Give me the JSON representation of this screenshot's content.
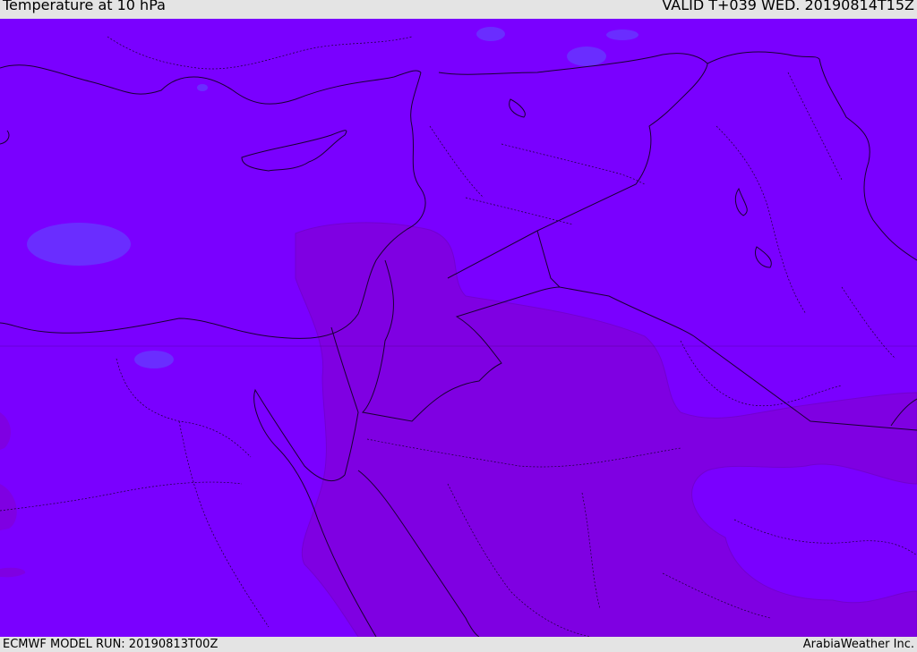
{
  "header": {
    "title": "Temperature at 10 hPa",
    "valid": "VALID T+039 WED. 20190814T15Z"
  },
  "footer": {
    "model_run": "ECMWF MODEL RUN: 20190813T00Z",
    "credit": "ArabiaWeather Inc."
  },
  "map": {
    "colors": {
      "field_main": "#7a00ff",
      "field_warm": "#7f00e2",
      "field_cool": "#6638ff",
      "border_line": "#1a0033"
    }
  }
}
